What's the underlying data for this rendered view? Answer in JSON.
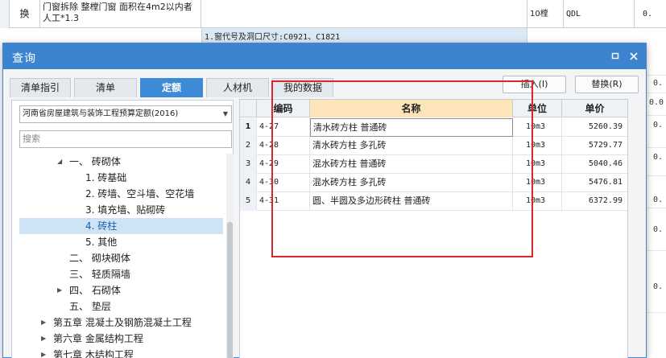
{
  "background": {
    "row1": {
      "col_a": "",
      "replace_label": "换",
      "description": "门窗拆除 整樘门窗  面积在4m2以内者 人工*1.3",
      "unit": "10樘",
      "qty_code": "QDL",
      "value": "0."
    },
    "row2": {
      "description": "1.窗代号及洞口尺寸:C0921、C1821"
    },
    "right_values": [
      "0.",
      "0.0",
      "0.",
      "0.",
      "0.",
      "0.",
      "0."
    ]
  },
  "dialog": {
    "title": "查询",
    "tabs": [
      {
        "label": "清单指引"
      },
      {
        "label": "清单"
      },
      {
        "label": "定额"
      },
      {
        "label": "人材机"
      },
      {
        "label": "我的数据"
      }
    ],
    "insert_label": "插入(I)",
    "replace_label": "替换(R)",
    "quota_library": "河南省房屋建筑与装饰工程预算定额(2016)",
    "search_placeholder": "搜索",
    "tree": [
      {
        "label": "一、 砖砌体"
      },
      {
        "label": "1. 砖基础"
      },
      {
        "label": "2. 砖墙、空斗墙、空花墙"
      },
      {
        "label": "3. 填充墙、贴砌砖"
      },
      {
        "label": "4. 砖柱"
      },
      {
        "label": "5. 其他"
      },
      {
        "label": "二、 砌块砌体"
      },
      {
        "label": "三、 轻质隔墙"
      },
      {
        "label": "四、 石砌体"
      },
      {
        "label": "五、 垫层"
      },
      {
        "label": "第五章 混凝土及钢筋混凝土工程"
      },
      {
        "label": "第六章 金属结构工程"
      },
      {
        "label": "第七章 木结构工程"
      }
    ],
    "table": {
      "headers": {
        "code": "编码",
        "name": "名称",
        "unit": "单位",
        "price": "单价"
      },
      "rows": [
        {
          "n": "1",
          "code": "4-27",
          "name": "清水砖方柱 普通砖",
          "unit": "10m3",
          "price": "5260.39"
        },
        {
          "n": "2",
          "code": "4-28",
          "name": "清水砖方柱 多孔砖",
          "unit": "10m3",
          "price": "5729.77"
        },
        {
          "n": "3",
          "code": "4-29",
          "name": "混水砖方柱 普通砖",
          "unit": "10m3",
          "price": "5040.46"
        },
        {
          "n": "4",
          "code": "4-30",
          "name": "混水砖方柱 多孔砖",
          "unit": "10m3",
          "price": "5476.81"
        },
        {
          "n": "5",
          "code": "4-31",
          "name": "圆、半圆及多边形砖柱 普通砖",
          "unit": "10m3",
          "price": "6372.99"
        }
      ]
    }
  }
}
